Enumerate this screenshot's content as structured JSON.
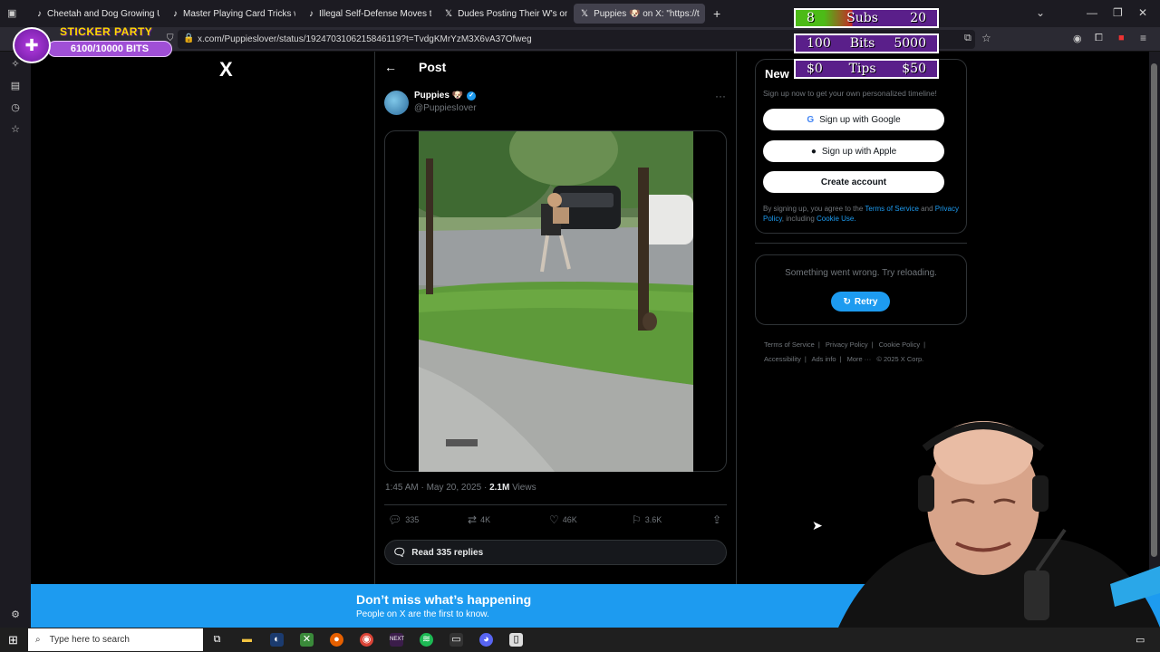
{
  "browser": {
    "tabs": [
      {
        "title": "Cheetah and Dog Growing Up T",
        "icon": "tiktok-icon"
      },
      {
        "title": "Master Playing Card Tricks with",
        "icon": "tiktok-icon"
      },
      {
        "title": "Illegal Self-Defense Moves to A",
        "icon": "tiktok-icon"
      },
      {
        "title": "Dudes Posting Their W's on X",
        "icon": "x-icon"
      },
      {
        "title": "Puppies 🐶 on X: \"https://t",
        "icon": "x-icon",
        "active": true
      }
    ],
    "url": "x.com/Puppieslover/status/1924703106215846119?t=TvdgKMrYzM3X6vA37Ofweg"
  },
  "post": {
    "header": "Post",
    "author_name": "Puppies 🐶",
    "author_handle": "@PuppiesIover",
    "time_date": "1:45 AM · May 20, 2025 · ",
    "views_count": "2.1M",
    "views_label": " Views",
    "replies": "335",
    "reposts": "4K",
    "likes": "46K",
    "bookmarks": "3.6K",
    "read_replies": "Read 335 replies"
  },
  "signup": {
    "title": "New",
    "subtitle": "Sign up now to get your own personalized timeline!",
    "google": "Sign up with Google",
    "apple": "Sign up with Apple",
    "create": "Create account",
    "terms_prefix": "By signing up, you agree to the ",
    "terms_link": "Terms of Service",
    "terms_and": " and ",
    "privacy_link": "Privacy Policy",
    "terms_incl": ", including ",
    "cookie_link": "Cookie Use."
  },
  "error": {
    "message": "Something went wrong. Try reloading.",
    "retry": "Retry"
  },
  "footer": {
    "links": [
      "Terms of Service",
      "|",
      "Privacy Policy",
      "|",
      "Cookie Policy",
      "|",
      "Accessibility",
      "|",
      "Ads info",
      "|",
      "More ···",
      "© 2025 X Corp."
    ]
  },
  "banner": {
    "title": "Don’t miss what’s happening",
    "subtitle": "People on X are the first to know."
  },
  "taskbar": {
    "search_placeholder": "Type here to search"
  },
  "overlay": {
    "sticker_title": "STICKER PARTY",
    "sticker_bits": "6100/10000 BITS",
    "goals": [
      {
        "left": "8",
        "label": "Subs",
        "right": "20"
      },
      {
        "left": "100",
        "label": "Bits",
        "right": "5000"
      },
      {
        "left": "$0",
        "label": "Tips",
        "right": "$50"
      }
    ],
    "subs_progress": 0.4
  },
  "colors": {
    "accent": "#1d9bf0",
    "background": "#000000",
    "overlay_purple": "#5a1f8a"
  }
}
